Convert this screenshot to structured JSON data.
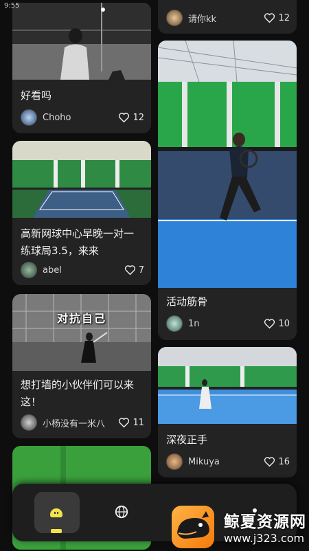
{
  "status_bar": {
    "time": "9:55"
  },
  "feed": {
    "left": [
      {
        "title": "好看吗",
        "author": "Choho",
        "likes": "12"
      },
      {
        "title": "高新网球中心早晚一对一练球局3.5，来来",
        "author": "abel",
        "likes": "7"
      },
      {
        "title": "想打墙的小伙伴们可以来这！",
        "author": "小杨没有一米八",
        "likes": "11",
        "overlay": "对抗自己"
      }
    ],
    "right": [
      {
        "author": "请你kk",
        "likes": "12"
      },
      {
        "title": "活动筋骨",
        "author": "1n",
        "likes": "10"
      },
      {
        "title": "深夜正手",
        "author": "Mikuya",
        "likes": "16"
      }
    ]
  },
  "watermark": {
    "name": "鲸夏资源网",
    "url": "www.j323.com"
  },
  "icons": {
    "like": "heart-outline-icon",
    "home": "home-icon",
    "discover": "globe-icon"
  },
  "colors": {
    "background": "#0e0e0e",
    "card": "#232323",
    "accent": "#f3e34a"
  }
}
